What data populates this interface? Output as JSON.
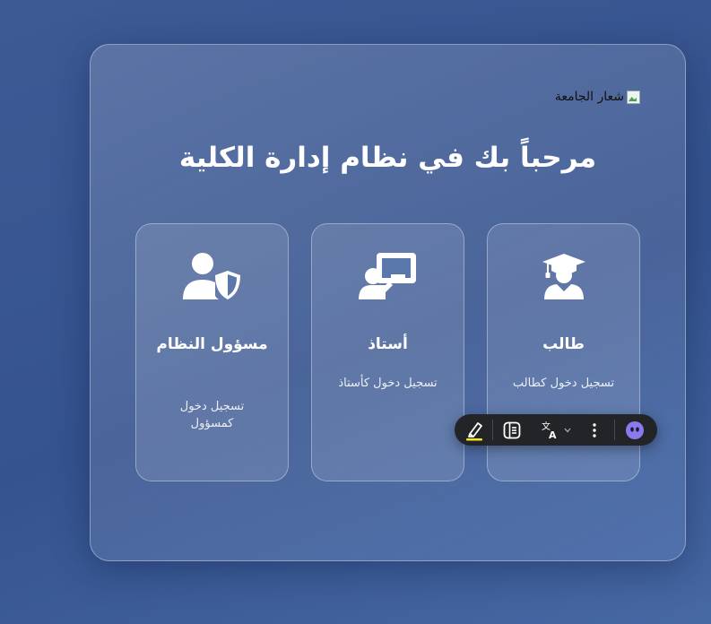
{
  "page": {
    "logo_alt": "شعار الجامعة",
    "heading": "مرحباً بك في نظام إدارة الكلية"
  },
  "cards": [
    {
      "title": "طالب",
      "desc": "تسجيل دخول كطالب",
      "icon": "graduate-icon"
    },
    {
      "title": "أستاذ",
      "desc": "تسجيل دخول كأستاذ",
      "icon": "teacher-board-icon"
    },
    {
      "title": "مسؤول النظام",
      "desc": "تسجيل دخول كمسؤول",
      "icon": "admin-shield-icon"
    }
  ],
  "toolbar": {
    "items": [
      "highlighter-icon",
      "reader-mode-icon",
      "translate-icon",
      "chevron-down-icon",
      "more-vertical-icon",
      "assistant-avatar-icon"
    ],
    "highlight_color": "#f6e71a",
    "assistant_color": "#8b79f0"
  },
  "colors": {
    "background": "#3a5694",
    "toolbar": "#232427"
  }
}
